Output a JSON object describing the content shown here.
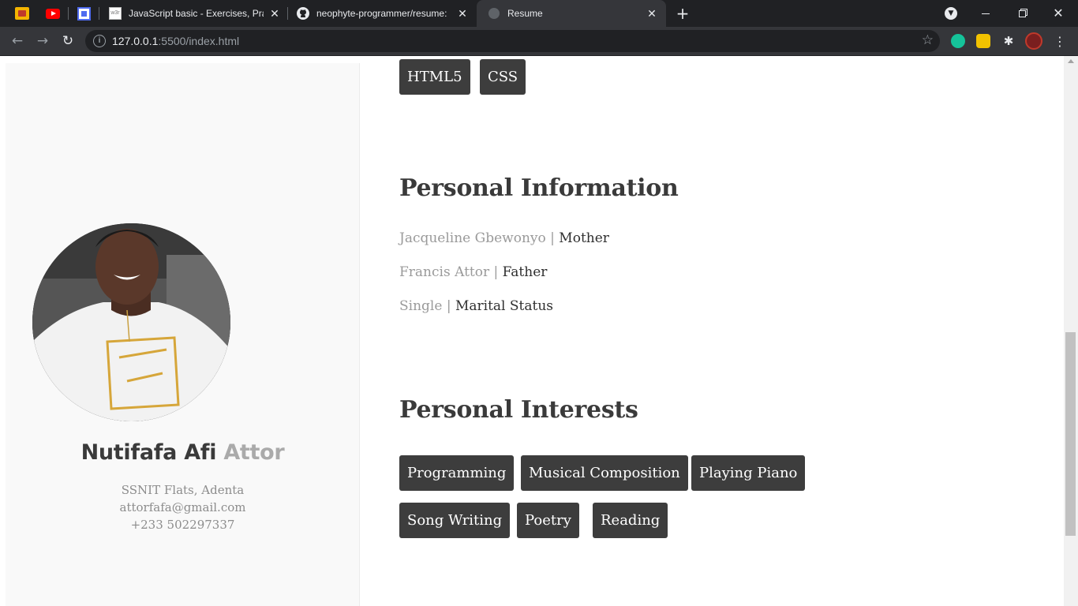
{
  "browser": {
    "tabs": [
      {
        "title": "JavaScript basic - Exercises, Pract",
        "favicon": "w3resource-icon"
      },
      {
        "title": "neophyte-programmer/resume: ",
        "favicon": "github-icon"
      },
      {
        "title": "Resume",
        "favicon": "globe-icon"
      }
    ],
    "new_tab_label": "+",
    "close_glyph": "✕",
    "address": {
      "host": "127.0.0.1",
      "path": ":5500/index.html"
    }
  },
  "resume": {
    "name_first": "Nutifafa Afi",
    "name_last": "Attor",
    "contact": {
      "address": "SSNIT Flats, Adenta",
      "email": "attorfafa@gmail.com",
      "phone": "+233 502297337"
    },
    "skills": [
      "HTML5",
      "CSS"
    ],
    "personal_information": {
      "title": "Personal Information",
      "separator": "|",
      "rows": [
        {
          "value": "Jacqueline Gbewonyo",
          "label": "Mother"
        },
        {
          "value": "Francis Attor",
          "label": "Father"
        },
        {
          "value": "Single",
          "label": "Marital Status"
        }
      ]
    },
    "personal_interests": {
      "title": "Personal Interests",
      "items": [
        "Programming",
        "Musical Composition",
        "Playing Piano",
        "Song Writing",
        "Poetry",
        "Reading"
      ]
    }
  },
  "colors": {
    "chrome_bg": "#202124",
    "toolbar_bg": "#35363a",
    "tag_bg": "#3d3d3d",
    "sidebar_bg": "#f9f9f9",
    "muted_text": "#9a9a9a"
  }
}
